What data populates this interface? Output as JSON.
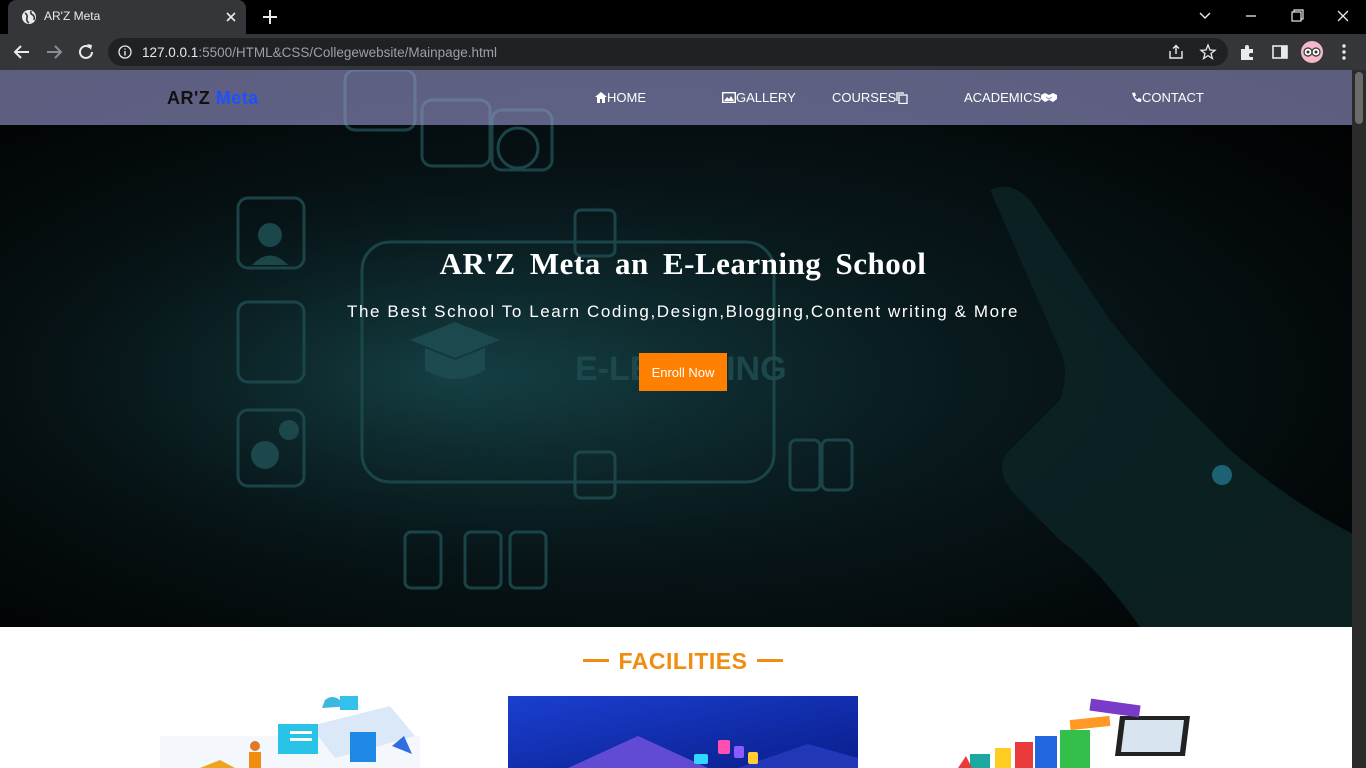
{
  "browser": {
    "tab_title": "AR'Z Meta",
    "url_host": "127.0.0.1",
    "url_path": ":5500/HTML&CSS/Collegewebsite/Mainpage.html"
  },
  "navbar": {
    "brand_main": "AR'Z",
    "brand_accent": "Meta",
    "items": [
      {
        "label": "HOME",
        "icon": "home-icon"
      },
      {
        "label": "GALLERY",
        "icon": "image-icon"
      },
      {
        "label": "COURSES",
        "icon": "copy-icon"
      },
      {
        "label": "ACADEMICS",
        "icon": "handshake-icon"
      },
      {
        "label": "CONTACT",
        "icon": "phone-icon"
      }
    ]
  },
  "hero": {
    "title": "AR'Z Meta an E-Learning School",
    "subtitle": "The Best School To Learn Coding,Design,Blogging,Content writing & More",
    "button": "Enroll Now"
  },
  "facilities": {
    "title": "FACILITIES"
  },
  "colors": {
    "accent": "#ff7f00",
    "brand_accent": "#1f4fff",
    "navbar": "#9696cd"
  }
}
